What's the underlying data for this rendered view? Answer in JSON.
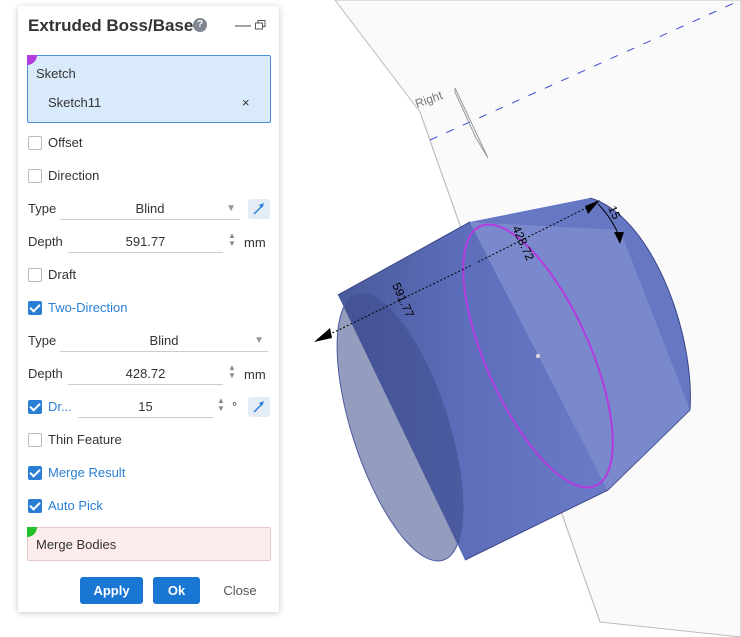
{
  "panel": {
    "title": "Extruded Boss/Base",
    "help_icon": "question-circle-icon",
    "sketch": {
      "label": "Sketch",
      "value": "Sketch11",
      "remove": "×"
    },
    "offset_label": "Offset",
    "direction_label": "Direction",
    "direction1": {
      "type_label": "Type",
      "type_value": "Blind",
      "depth_label": "Depth",
      "depth_value": "591.77",
      "depth_unit": "mm"
    },
    "draft_label": "Draft",
    "two_direction_label": "Two-Direction",
    "direction2": {
      "type_label": "Type",
      "type_value": "Blind",
      "depth_label": "Depth",
      "depth_value": "428.72",
      "depth_unit": "mm",
      "draft_label": "Dr...",
      "draft_value": "15",
      "draft_unit": "°"
    },
    "thin_feature_label": "Thin Feature",
    "merge_result_label": "Merge Result",
    "auto_pick_label": "Auto Pick",
    "merge_bodies_label": "Merge Bodies",
    "buttons": {
      "apply": "Apply",
      "ok": "Ok",
      "close": "Close"
    },
    "checkbox_state": {
      "offset": false,
      "direction": false,
      "draft": false,
      "two_direction": true,
      "draft2": true,
      "thin_feature": false,
      "merge_result": true,
      "auto_pick": true
    }
  },
  "viewport": {
    "plane_label": "Right",
    "dim_depth1": "591.77",
    "dim_depth2": "428.72",
    "dim_angle": "15"
  },
  "colors": {
    "accent": "#1976d2",
    "body": "#5d6eb8",
    "profile": "#b33be0"
  }
}
